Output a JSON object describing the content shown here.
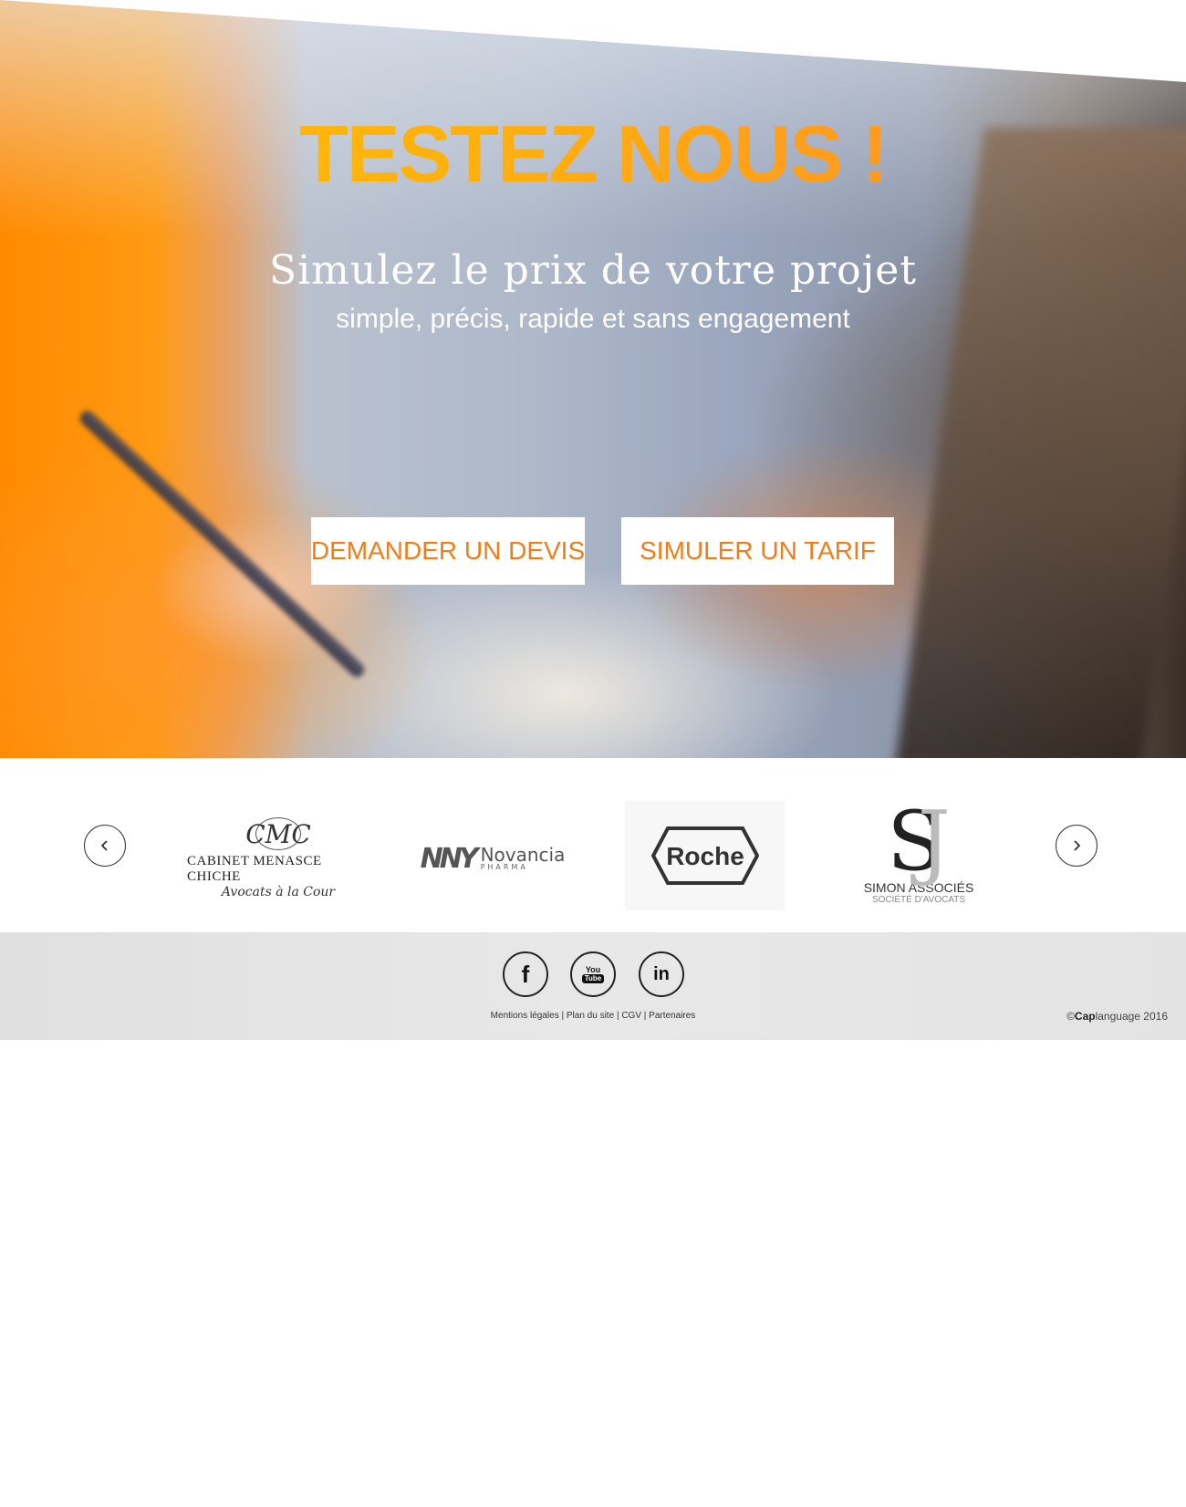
{
  "hero": {
    "headline": "TESTEZ NOUS !",
    "subtitle": "Simulez le prix de votre projet",
    "tagline": "simple, précis, rapide et sans engagement",
    "buttons": {
      "quote_label": "DEMANDER UN DEVIS",
      "simulate_label": "SIMULER UN TARIF"
    },
    "colors": {
      "headline_start": "#ffbf00",
      "headline_end": "#ff8a2a",
      "button_text": "#f07d1a",
      "accent_orange": "#ff8a00"
    }
  },
  "carousel": {
    "prev_icon": "chevron-left-icon",
    "next_icon": "chevron-right-icon",
    "logos": [
      {
        "monogram": "CMC",
        "name": "CABINET MENASCE CHICHE",
        "subtitle": "Avocats à la Cour"
      },
      {
        "mark": "NNY",
        "name": "Novancia",
        "subtitle": "PHARMA"
      },
      {
        "name": "Roche"
      },
      {
        "monogram": "SJ",
        "name": "SIMON ASSOCIÉS",
        "subtitle": "SOCIÉTÉ D'AVOCATS"
      }
    ]
  },
  "footer": {
    "social": {
      "facebook_glyph": "f",
      "youtube_top": "You",
      "youtube_bottom": "Tube",
      "linkedin_glyph": "in"
    },
    "links": [
      "Mentions légales",
      "Plan du site",
      "CGV",
      "Partenaires"
    ],
    "separator": "|",
    "copyright_symbol": "©",
    "copyright_brand": "Cap",
    "copyright_rest": "language 2016"
  }
}
